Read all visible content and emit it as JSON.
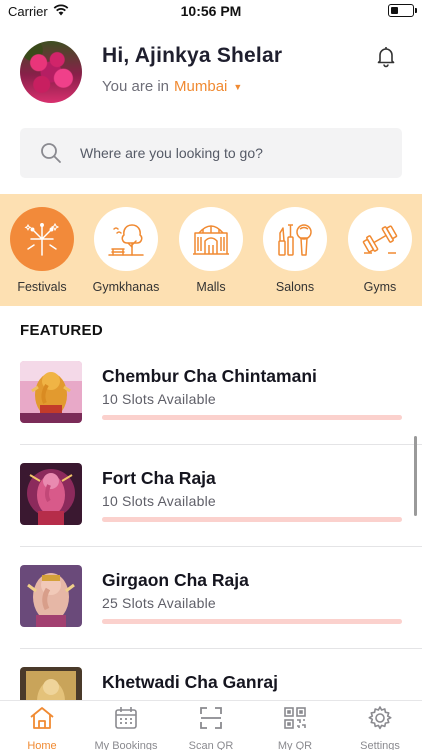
{
  "status_bar": {
    "carrier": "Carrier",
    "time": "10:56 PM",
    "battery_level": 0.35
  },
  "header": {
    "greeting": "Hi, Ajinkya Shelar",
    "location_prefix": "You are in",
    "city": "Mumbai",
    "caret": "▼",
    "bell_icon": "bell-icon"
  },
  "search": {
    "placeholder": "Where are you looking to go?"
  },
  "categories": [
    {
      "label": "Festivals",
      "icon": "fireworks-icon",
      "active": true
    },
    {
      "label": "Gymkhanas",
      "icon": "park-bench-icon",
      "active": false
    },
    {
      "label": "Malls",
      "icon": "mall-building-icon",
      "active": false
    },
    {
      "label": "Salons",
      "icon": "salon-tools-icon",
      "active": false
    },
    {
      "label": "Gyms",
      "icon": "dumbbell-icon",
      "active": false
    }
  ],
  "featured": {
    "title": "FEATURED",
    "items": [
      {
        "name": "Chembur Cha Chintamani",
        "slots": "10 Slots Available",
        "fill": 1.0
      },
      {
        "name": "Fort Cha Raja",
        "slots": "10 Slots Available",
        "fill": 1.0
      },
      {
        "name": "Girgaon Cha Raja",
        "slots": "25 Slots Available",
        "fill": 1.0
      },
      {
        "name": "Khetwadi Cha Ganraj",
        "slots": "",
        "fill": 1.0
      }
    ]
  },
  "tabs": [
    {
      "label": "Home",
      "icon": "home-icon",
      "active": true
    },
    {
      "label": "My Bookings",
      "icon": "calendar-icon",
      "active": false
    },
    {
      "label": "Scan QR",
      "icon": "scan-qr-icon",
      "active": false
    },
    {
      "label": "My QR",
      "icon": "qr-code-icon",
      "active": false
    },
    {
      "label": "Settings",
      "icon": "gear-icon",
      "active": false
    }
  ],
  "colors": {
    "accent": "#f08a32",
    "category_band": "#fde0b2",
    "slot_bar": "#fde3e1"
  }
}
